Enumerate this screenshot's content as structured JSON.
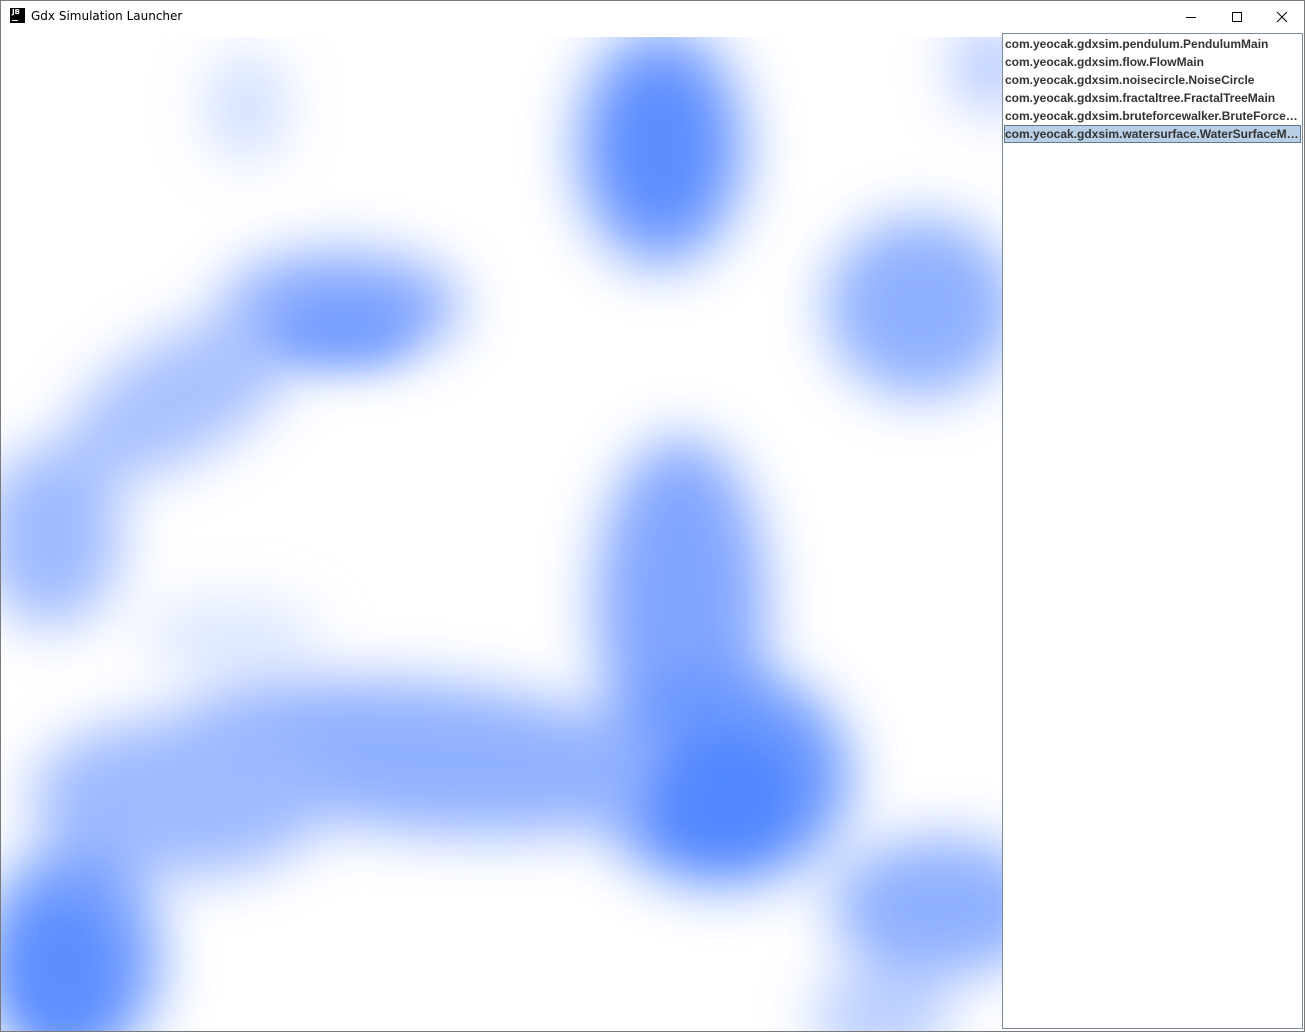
{
  "window": {
    "title": "Gdx Simulation Launcher",
    "icon": "jb-app-icon",
    "icon_text": "JB",
    "controls": [
      "minimize-icon",
      "maximize-icon",
      "close-icon"
    ]
  },
  "list": {
    "items": [
      {
        "label": "com.yeocak.gdxsim.pendulum.PendulumMain",
        "selected": false
      },
      {
        "label": "com.yeocak.gdxsim.flow.FlowMain",
        "selected": false
      },
      {
        "label": "com.yeocak.gdxsim.noisecircle.NoiseCircle",
        "selected": false
      },
      {
        "label": "com.yeocak.gdxsim.fractaltree.FractalTreeMain",
        "selected": false
      },
      {
        "label": "com.yeocak.gdxsim.bruteforcewalker.BruteForceWalkerMain",
        "selected": false
      },
      {
        "label": "com.yeocak.gdxsim.watersurface.WaterSurfaceMain",
        "selected": true
      }
    ]
  },
  "colors": {
    "water_blue": "#4a82ff",
    "selection_bg": "#b8cfe5",
    "selection_border": "#637b92"
  }
}
